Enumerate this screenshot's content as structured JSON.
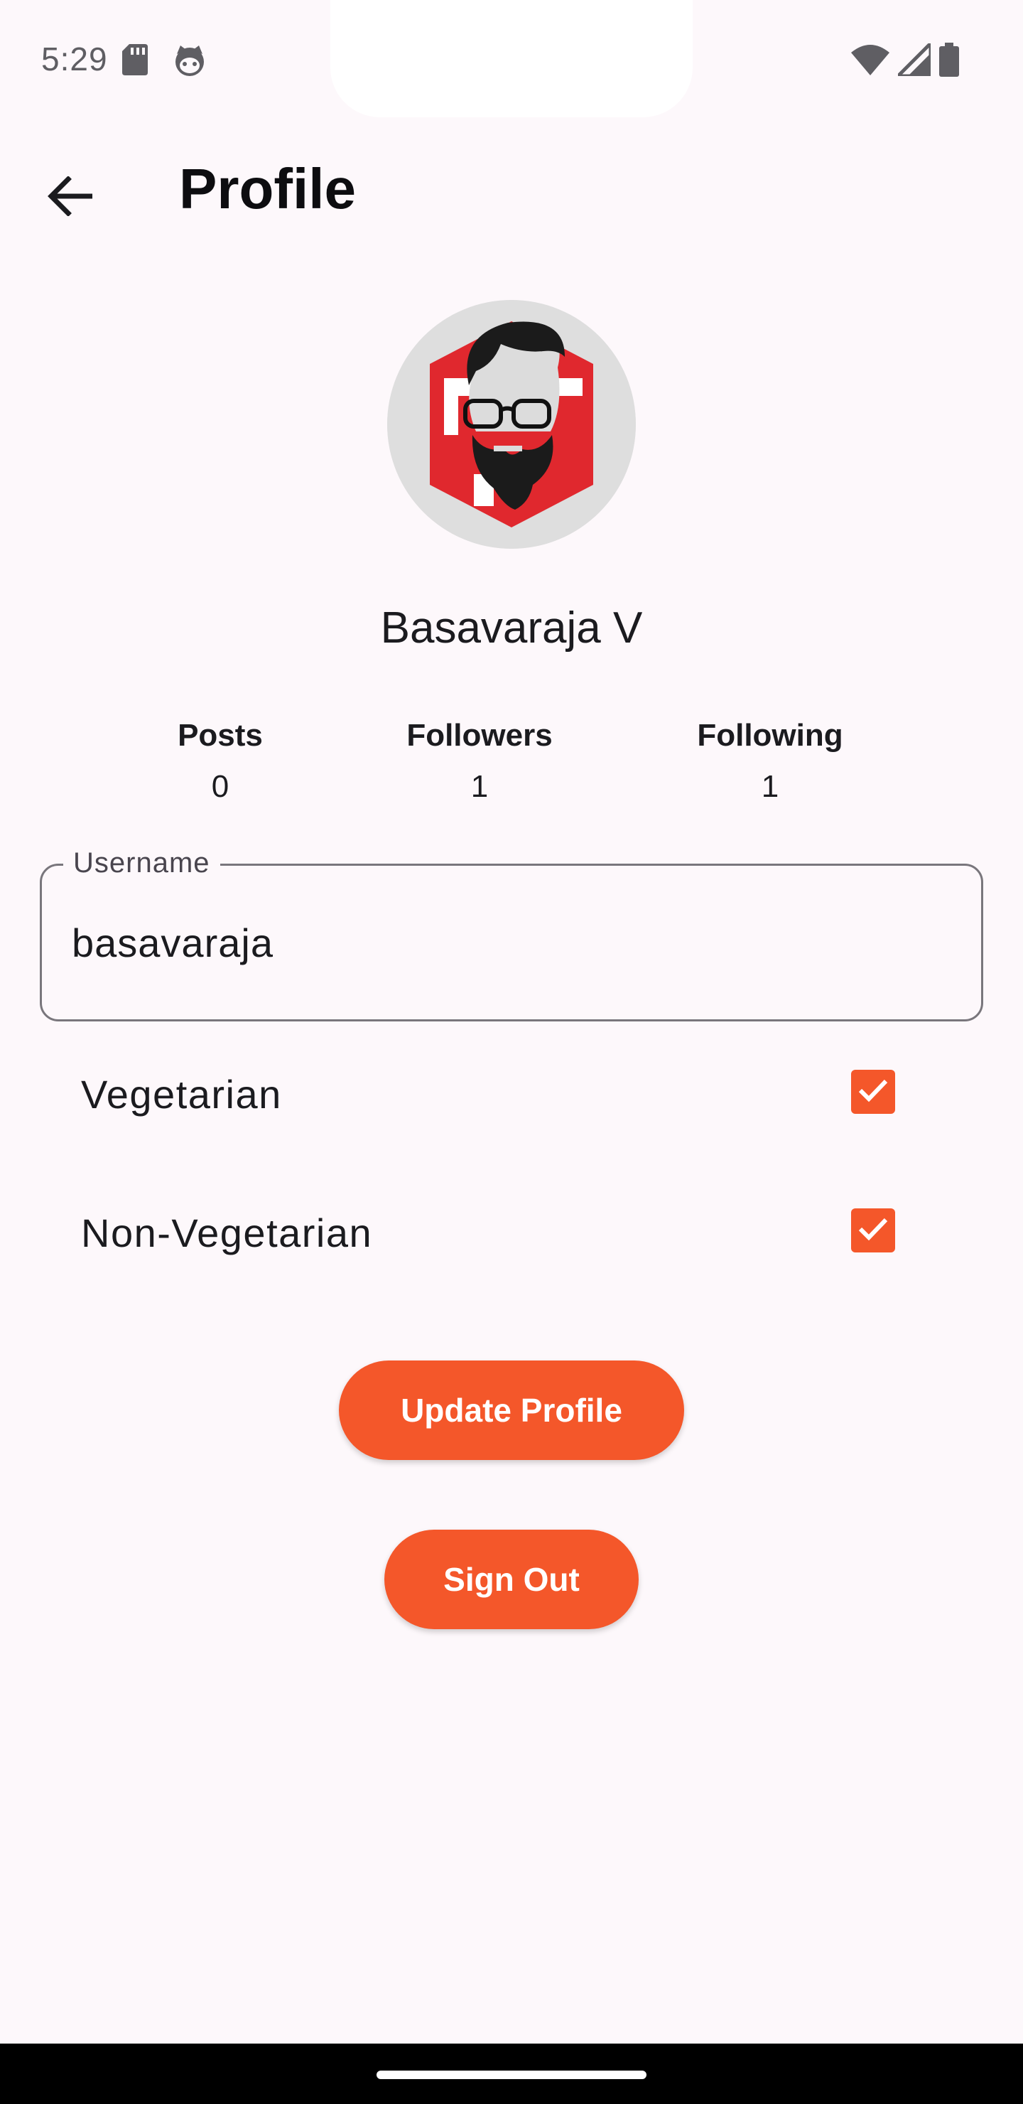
{
  "status_bar": {
    "time": "5:29",
    "icons": [
      "sd-card-icon",
      "cat-face-icon",
      "wifi-icon",
      "cellular-signal-icon",
      "battery-icon"
    ]
  },
  "app_bar": {
    "title": "Profile",
    "back_icon": "arrow-left-icon"
  },
  "profile": {
    "display_name": "Basavaraja V",
    "avatar_icon": "bearded-man-avatar-icon"
  },
  "stats": {
    "posts_label": "Posts",
    "posts_value": "0",
    "followers_label": "Followers",
    "followers_value": "1",
    "following_label": "Following",
    "following_value": "1"
  },
  "username_field": {
    "label": "Username",
    "value": "basavaraja"
  },
  "preferences": {
    "vegetarian_label": "Vegetarian",
    "vegetarian_checked": true,
    "non_vegetarian_label": "Non-Vegetarian",
    "non_vegetarian_checked": true
  },
  "actions": {
    "update_label": "Update Profile",
    "sign_out_label": "Sign Out"
  },
  "colors": {
    "accent": "#f4572a",
    "background": "#fdf8fb",
    "text": "#1b1b1f",
    "outline": "#79767c"
  }
}
